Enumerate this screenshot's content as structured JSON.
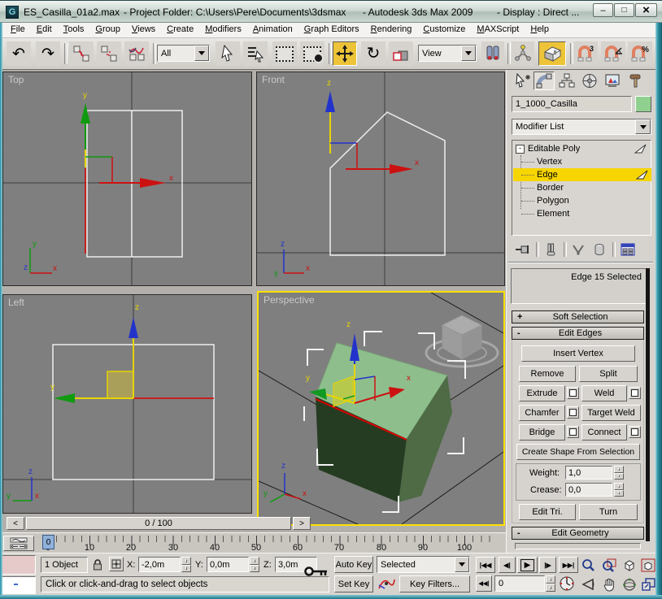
{
  "window": {
    "icon_letter": "G",
    "title_file": "ES_Casilla_01a2.max",
    "title_project": "- Project Folder: C:\\Users\\Pere\\Documents\\3dsmax",
    "title_app": "- Autodesk 3ds Max  2009",
    "title_display": "- Display : Direct ..."
  },
  "menu": {
    "items": [
      "File",
      "Edit",
      "Tools",
      "Group",
      "Views",
      "Create",
      "Modifiers",
      "Animation",
      "Graph Editors",
      "Rendering",
      "Customize",
      "MAXScript",
      "Help"
    ]
  },
  "toolbar": {
    "selection_filter": "All",
    "coord_system": "View"
  },
  "viewports": {
    "top": "Top",
    "front": "Front",
    "left": "Left",
    "perspective": "Perspective",
    "axis_x": "x",
    "axis_y": "y",
    "axis_z": "z"
  },
  "command_panel": {
    "object_name": "1_1000_Casilla",
    "modifier_list": "Modifier List",
    "stack_root": "Editable Poly",
    "stack_items": [
      "Vertex",
      "Edge",
      "Border",
      "Polygon",
      "Element"
    ],
    "selection_status": "Edge 15 Selected",
    "soft_selection": "Soft Selection",
    "edit_edges": "Edit Edges",
    "edit_geometry": "Edit Geometry",
    "btn_insert_vertex": "Insert Vertex",
    "btn_remove": "Remove",
    "btn_split": "Split",
    "btn_extrude": "Extrude",
    "btn_weld": "Weld",
    "btn_chamfer": "Chamfer",
    "btn_target_weld": "Target Weld",
    "btn_bridge": "Bridge",
    "btn_connect": "Connect",
    "btn_create_shape": "Create Shape From Selection",
    "btn_edit_tri": "Edit Tri.",
    "btn_turn": "Turn",
    "weight_label": "Weight:",
    "weight_value": "1,0",
    "crease_label": "Crease:",
    "crease_value": "0,0"
  },
  "timeline": {
    "time_slider": "0 / 100",
    "ruler_labels": [
      "0",
      "10",
      "20",
      "30",
      "40",
      "50",
      "60",
      "70",
      "80",
      "90",
      "100"
    ],
    "slider_frame": "0"
  },
  "status": {
    "object_count": "1 Object",
    "x_label": "X:",
    "x_value": "-2,0m",
    "y_label": "Y:",
    "y_value": "0,0m",
    "z_label": "Z:",
    "z_value": "3,0m",
    "prompt": "Click or click-and-drag to select objects",
    "auto_key": "Auto Key",
    "set_key": "Set Key",
    "key_mode": "Selected",
    "key_filters": "Key Filters...",
    "frame_value": "0"
  },
  "icons": {
    "undo": "↶",
    "redo": "↷",
    "rotate": "↻",
    "window_min": "–",
    "window_max": "□",
    "window_close": "×",
    "slider_prev": "<",
    "slider_next": ">",
    "go_start": "|◀◀",
    "prev_frame": "◀|",
    "play": "▶",
    "next_frame": "|▶",
    "go_end": "▶▶|",
    "key_mode_toggle": "◀◀|",
    "plus": "+",
    "minus": "-",
    "snap_count": "3",
    "percent": "%"
  },
  "colors": {
    "active_viewport_border": "#FFE000",
    "selection_highlight": "#F6D500",
    "object_color": "#8FD08F",
    "selected_edge": "#DD0000",
    "viewport_bg": "#7F7F7F"
  }
}
